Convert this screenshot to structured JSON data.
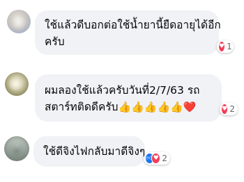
{
  "comments": [
    {
      "text_lines": [
        "ใช้แล้วดีบอกต่อใช้น้ำยานี้ยืดอายุได้อีก",
        "ครับ"
      ],
      "reactions": {
        "icons": [
          "love-icon"
        ],
        "count": "1"
      }
    },
    {
      "text_lines": [
        "ผมลองใช้แล้วครับวันที่2/7/63 รถ",
        "สตาร์ทติดดีครับ"
      ],
      "trailing_emoji": "👍👍👍👍👍❤️",
      "reactions": {
        "icons": [
          "love-icon"
        ],
        "count": "2"
      }
    },
    {
      "text_lines": [
        "ใช้ดีจิงไฟกลับมาดีจิงๆ"
      ],
      "reactions": {
        "icons": [
          "like-icon",
          "love-icon"
        ],
        "count": "2"
      }
    }
  ],
  "colors": {
    "bubble": "#f0f2f5",
    "like": "#1877f2",
    "love": "#f33e58",
    "count_text": "#65676b"
  }
}
